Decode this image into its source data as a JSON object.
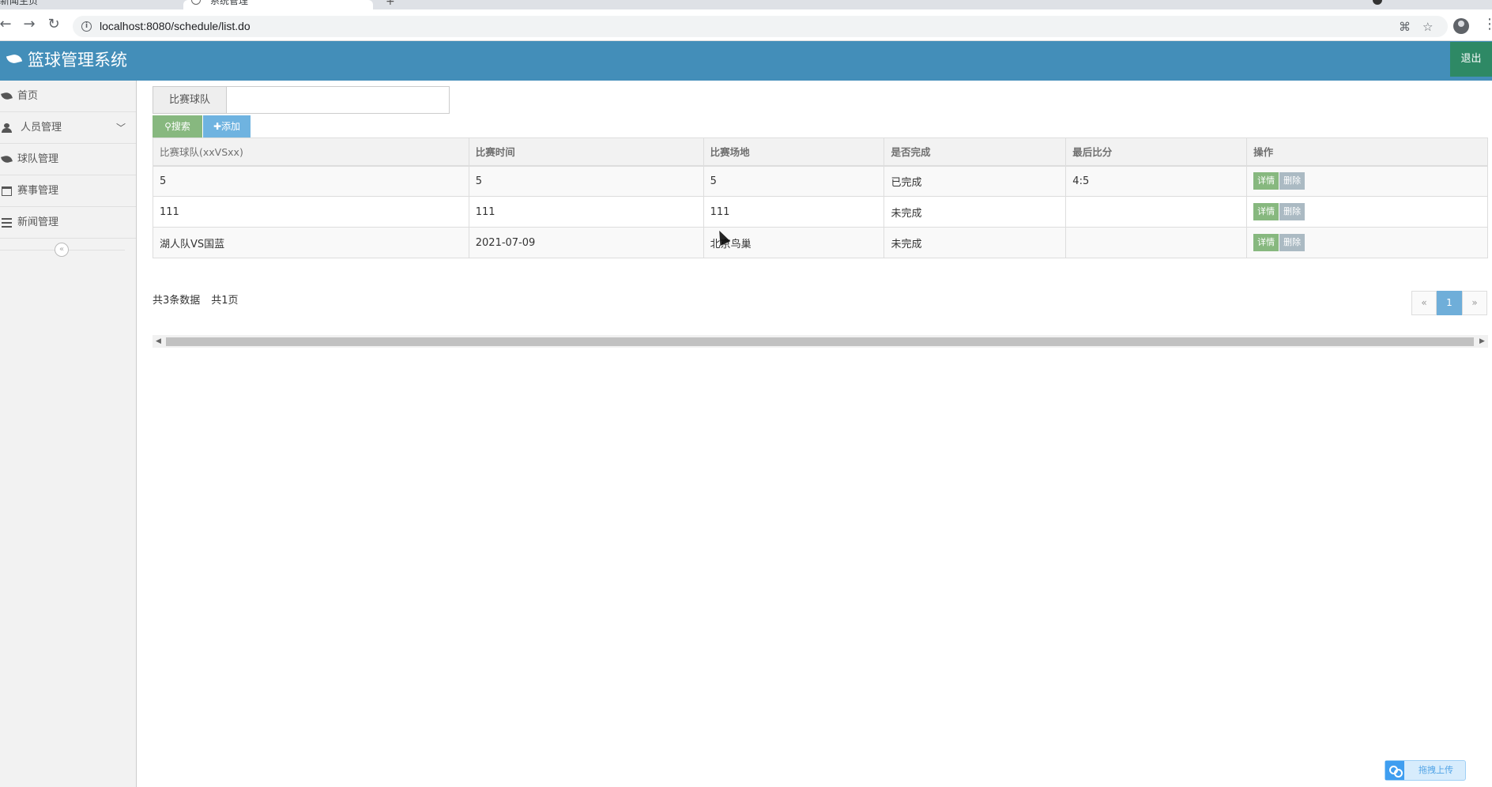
{
  "browser": {
    "tabs": [
      {
        "label": "新闻主页"
      },
      {
        "label": "系统管理"
      }
    ],
    "url": "localhost:8080/schedule/list.do"
  },
  "header": {
    "brand": "篮球管理系统",
    "logout_label": "退出",
    "colors": {
      "header_bg": "#438eb9",
      "logout_bg": "#2e8965"
    }
  },
  "sidebar": {
    "items": [
      {
        "label": "首页",
        "icon": "leaf-icon"
      },
      {
        "label": "人员管理",
        "icon": "user-icon",
        "has_submenu": true
      },
      {
        "label": "球队管理",
        "icon": "leaf-icon"
      },
      {
        "label": "赛事管理",
        "icon": "calendar-icon"
      },
      {
        "label": "新闻管理",
        "icon": "list-icon"
      }
    ],
    "collapse_glyph": "«"
  },
  "search": {
    "label": "比赛球队",
    "value": "",
    "search_button": "搜索",
    "add_button": "添加"
  },
  "table": {
    "columns": [
      "比赛球队(xxVSxx)",
      "比赛时间",
      "比赛场地",
      "是否完成",
      "最后比分",
      "操作"
    ],
    "rows": [
      {
        "team": "5",
        "time": "5",
        "venue": "5",
        "done": "已完成",
        "score": "4:5"
      },
      {
        "team": "111",
        "time": "111",
        "venue": "111",
        "done": "未完成",
        "score": ""
      },
      {
        "team": "湖人队VS国蓝",
        "time": "2021-07-09",
        "venue": "北京鸟巢",
        "done": "未完成",
        "score": ""
      }
    ],
    "actions": {
      "detail": "详情",
      "delete": "删除"
    }
  },
  "pagination": {
    "total_records": "共3条数据",
    "total_pages": "共1页",
    "prev": "«",
    "current": "1",
    "next": "»"
  },
  "upload_widget": {
    "label": "拖拽上传"
  }
}
